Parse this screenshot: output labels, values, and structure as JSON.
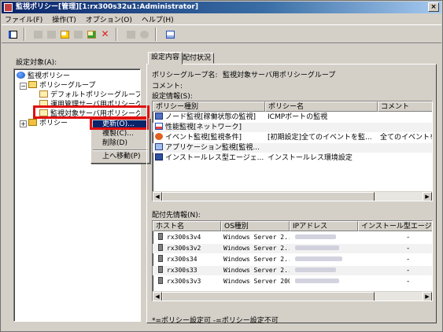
{
  "window": {
    "title": "監視ポリシー[管理][1:rx300s32u1:Administrator]",
    "close_glyph": "×"
  },
  "menu": [
    "ファイル(F)",
    "操作(T)",
    "オプション(O)",
    "ヘルプ(H)"
  ],
  "tree": {
    "label": "設定対象(A):",
    "root": "監視ポリシー",
    "policy_group": "ポリシーグループ",
    "default_group": "デフォルトポリシーグループ",
    "ops_group": "運用管理サーバ用ポリシーグループ",
    "monitored_group": "監視対象サーバ用ポリシーグループ",
    "policy": "ポリシー"
  },
  "context_menu": {
    "refresh": "更新(O)...",
    "rename": "複製(C)...",
    "delete": "削除(D)",
    "move_up": "上へ移動(P)"
  },
  "tabs": [
    "設定内容",
    "配付状況"
  ],
  "details": {
    "group_name_label": "ポリシーグループ名:",
    "group_name_value": "監視対象サーバ用ポリシーグループ",
    "comment_label": "コメント:",
    "settings_label": "設定情報(S):"
  },
  "settings_table": {
    "columns": [
      "ポリシー種別",
      "ポリシー名",
      "コメント"
    ],
    "rows": [
      {
        "icon": "node-monitor-icon",
        "type": "ノード監視[稼働状態の監視]",
        "name": "ICMPポートの監視",
        "comment": ""
      },
      {
        "icon": "performance-monitor-icon",
        "type": "性能監視[ネットワーク]",
        "name": "",
        "comment": ""
      },
      {
        "icon": "event-monitor-icon",
        "type": "イベント監視[監視条件]",
        "name": "[初期設定]全てのイベントを監...",
        "comment": "全てのイベントを"
      },
      {
        "icon": "app-monitor-icon",
        "type": "アプリケーション監視[監視...",
        "name": "",
        "comment": ""
      },
      {
        "icon": "agentless-install-icon",
        "type": "インストールレス型エージェ...",
        "name": "インストールレス環境設定",
        "comment": ""
      }
    ]
  },
  "dist_label": "配付先情報(N):",
  "dist_table": {
    "columns": [
      "ホスト名",
      "OS種別",
      "IPアドレス",
      "インストール型エージェ"
    ],
    "rows": [
      {
        "host": "rx300s3v4",
        "os": "Windows Server 2...",
        "agent": "-"
      },
      {
        "host": "rx300s3v2",
        "os": "Windows Server 2...",
        "agent": "-"
      },
      {
        "host": "rx300s34",
        "os": "Windows Server 2...",
        "agent": "-"
      },
      {
        "host": "rx300s33",
        "os": "Windows Server 2...",
        "agent": "-"
      },
      {
        "host": "rx300s3v3",
        "os": "Windows Server 2008",
        "agent": "-"
      }
    ]
  },
  "legend": "*=ポリシー設定可  -=ポリシー設定不可",
  "colors": {
    "highlight": "#e01010",
    "selection": "#0a246a",
    "title_bar": "#0a246a"
  }
}
